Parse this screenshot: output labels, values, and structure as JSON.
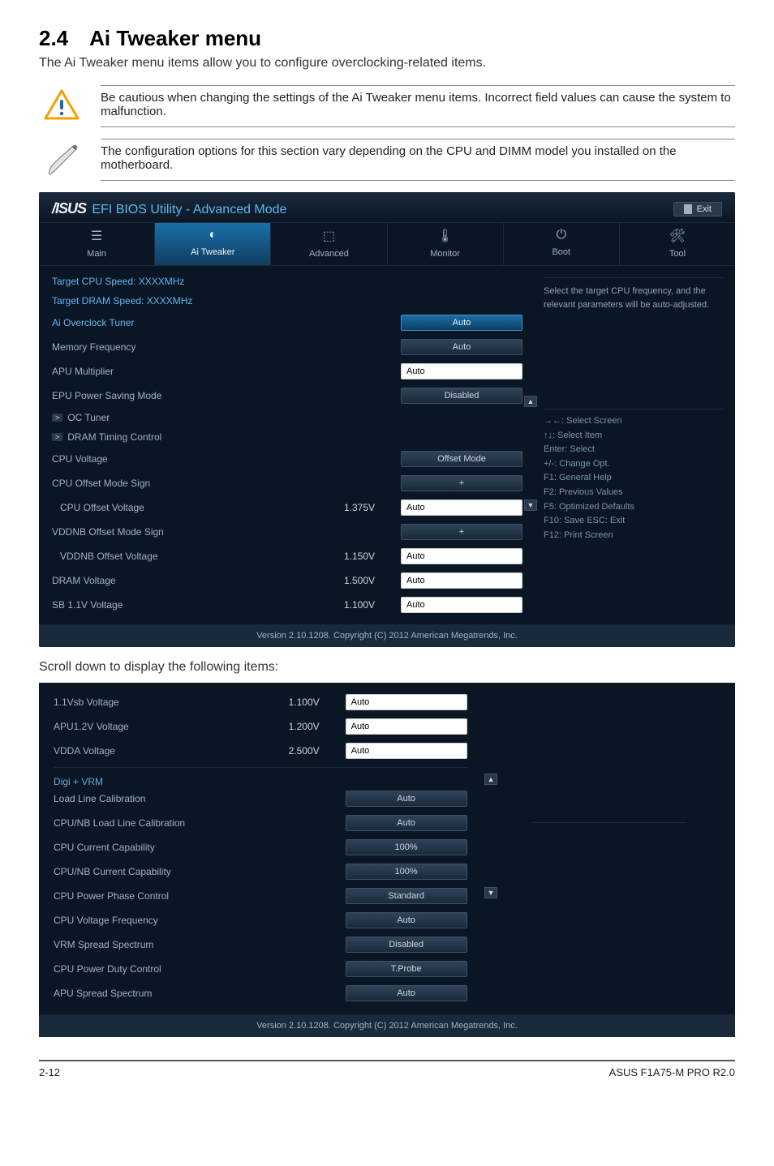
{
  "heading": "2.4 Ai Tweaker menu",
  "intro": "The Ai Tweaker menu items allow you to configure overclocking-related items.",
  "callout_caution": "Be cautious when changing the settings of the Ai Tweaker menu items. Incorrect field values can cause the system to malfunction.",
  "callout_note": "The configuration options for this section vary depending on the CPU and DIMM model you installed on the motherboard.",
  "bios": {
    "logo": "/ISUS",
    "title": "EFI BIOS Utility - Advanced Mode",
    "exit": "Exit",
    "tabs": {
      "main": "Main",
      "tweaker": "Ai  Tweaker",
      "advanced": "Advanced",
      "monitor": "Monitor",
      "boot": "Boot",
      "tool": "Tool"
    },
    "targets": {
      "cpu": "Target CPU Speed: XXXXMHz",
      "dram": "Target DRAM Speed: XXXXMHz"
    },
    "fields": {
      "ai_oc": {
        "label": "Ai Overclock Tuner",
        "value": "Auto"
      },
      "mem_freq": {
        "label": "Memory Frequency",
        "value": "Auto"
      },
      "apu_mult": {
        "label": "APU Multiplier",
        "value": "Auto"
      },
      "epu": {
        "label": "EPU Power Saving Mode",
        "value": "Disabled"
      },
      "oc_tuner": {
        "label": "OC Tuner"
      },
      "dram_timing": {
        "label": "DRAM Timing Control"
      },
      "cpu_voltage": {
        "label": "CPU Voltage",
        "value": "Offset Mode"
      },
      "cpu_off_sign": {
        "label": "CPU Offset Mode Sign",
        "value": "+"
      },
      "cpu_off_v": {
        "label": "CPU Offset Voltage",
        "mid": "1.375V",
        "value": "Auto"
      },
      "vddnb_sign": {
        "label": "VDDNB Offset Mode Sign",
        "value": "+"
      },
      "vddnb_off": {
        "label": "VDDNB Offset Voltage",
        "mid": "1.150V",
        "value": "Auto"
      },
      "dram_v": {
        "label": "DRAM Voltage",
        "mid": "1.500V",
        "value": "Auto"
      },
      "sb11": {
        "label": "SB 1.1V Voltage",
        "mid": "1.100V",
        "value": "Auto"
      }
    },
    "side_help": "Select the target CPU frequency, and the relevant parameters will be auto-adjusted.",
    "keys": {
      "k1": "→←:  Select Screen",
      "k2": "↑↓:  Select Item",
      "k3": "Enter:  Select",
      "k4": "+/-:  Change Opt.",
      "k5": "F1:  General Help",
      "k6": "F2:  Previous Values",
      "k7": "F5:  Optimized Defaults",
      "k8": "F10:  Save   ESC:  Exit",
      "k9": "F12:  Print Screen"
    },
    "footer": "Version  2.10.1208.   Copyright  (C)  2012  American  Megatrends,  Inc."
  },
  "scroll_note": "Scroll down to display the following items:",
  "cont": {
    "vsb": {
      "label": "1.1Vsb Voltage",
      "mid": "1.100V",
      "value": "Auto"
    },
    "apu12": {
      "label": "APU1.2V Voltage",
      "mid": "1.200V",
      "value": "Auto"
    },
    "vdda": {
      "label": "VDDA Voltage",
      "mid": "2.500V",
      "value": "Auto"
    },
    "digi": "Digi + VRM",
    "llc": {
      "label": "Load Line Calibration",
      "value": "Auto"
    },
    "cpunb_llc": {
      "label": "CPU/NB Load Line Calibration",
      "value": "Auto"
    },
    "cpu_cap": {
      "label": "CPU Current Capability",
      "value": "100%"
    },
    "cpunb_cap": {
      "label": "CPU/NB Current Capability",
      "value": "100%"
    },
    "phase": {
      "label": "CPU Power Phase Control",
      "value": "Standard"
    },
    "cpu_vfreq": {
      "label": "CPU Voltage Frequency",
      "value": "Auto"
    },
    "vrm_ss": {
      "label": "VRM Spread Spectrum",
      "value": "Disabled"
    },
    "duty": {
      "label": "CPU Power Duty Control",
      "value": "T.Probe"
    },
    "apu_ss": {
      "label": "APU Spread Spectrum",
      "value": "Auto"
    }
  },
  "pagefoot": {
    "left": "2-12",
    "right": "ASUS F1A75-M PRO R2.0"
  }
}
